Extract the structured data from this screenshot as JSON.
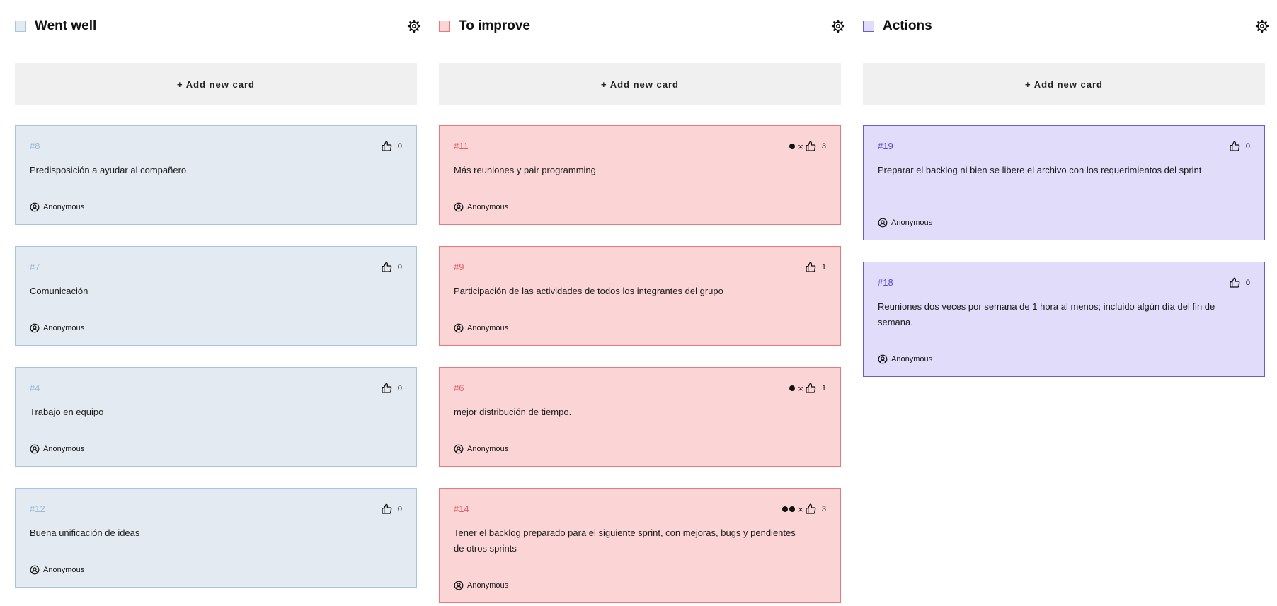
{
  "theme": {
    "went_well": {
      "bg": "#e3eaf2",
      "border": "#a8c4de",
      "id_color": "#9dbad4",
      "swatch_bg": "#e3eaf2",
      "swatch_border": "#a8c4de"
    },
    "to_improve": {
      "bg": "#fbd5d6",
      "border": "#e6797d",
      "id_color": "#e0606a",
      "swatch_bg": "#fbd5d6",
      "swatch_border": "#e6797d"
    },
    "actions": {
      "bg": "#e0dcf9",
      "border": "#6a5ae0",
      "id_color": "#5a48d6",
      "swatch_bg": "#e0dcf9",
      "swatch_border": "#6a5ae0"
    }
  },
  "columns": [
    {
      "key": "went_well",
      "title": "Went well",
      "add_label": "+ Add new card",
      "cards": [
        {
          "id": "#8",
          "text": "Predisposición a ayudar al compañero",
          "author": "Anonymous",
          "votes": "0",
          "voter_dots": 0,
          "can_remove": false
        },
        {
          "id": "#7",
          "text": "Comunicación",
          "author": "Anonymous",
          "votes": "0",
          "voter_dots": 0,
          "can_remove": false
        },
        {
          "id": "#4",
          "text": "Trabajo en equipo",
          "author": "Anonymous",
          "votes": "0",
          "voter_dots": 0,
          "can_remove": false
        },
        {
          "id": "#12",
          "text": "Buena unificación de ideas",
          "author": "Anonymous",
          "votes": "0",
          "voter_dots": 0,
          "can_remove": false
        }
      ]
    },
    {
      "key": "to_improve",
      "title": "To improve",
      "add_label": "+ Add new card",
      "cards": [
        {
          "id": "#11",
          "text": "Más reuniones y pair programming",
          "author": "Anonymous",
          "votes": "3",
          "voter_dots": 1,
          "can_remove": true
        },
        {
          "id": "#9",
          "text": "Participación de las actividades de todos los integrantes del grupo",
          "author": "Anonymous",
          "votes": "1",
          "voter_dots": 0,
          "can_remove": false
        },
        {
          "id": "#6",
          "text": "mejor distribución de tiempo.",
          "author": "Anonymous",
          "votes": "1",
          "voter_dots": 1,
          "can_remove": true
        },
        {
          "id": "#14",
          "text": "Tener el backlog preparado para el siguiente sprint, con mejoras, bugs y pendientes de otros sprints",
          "author": "Anonymous",
          "votes": "3",
          "voter_dots": 2,
          "can_remove": true
        }
      ]
    },
    {
      "key": "actions",
      "title": "Actions",
      "add_label": "+ Add new card",
      "cards": [
        {
          "id": "#19",
          "text": "Preparar el backlog ni bien se libere el archivo con los requerimientos del sprint",
          "author": "Anonymous",
          "votes": "0",
          "voter_dots": 0,
          "can_remove": false
        },
        {
          "id": "#18",
          "text": "Reuniones dos veces por semana de 1 hora al menos; incluido algún día del fin de semana.",
          "author": "Anonymous",
          "votes": "0",
          "voter_dots": 0,
          "can_remove": false
        }
      ]
    }
  ],
  "icons": {
    "settings": "gear-icon",
    "vote": "thumbs-up-icon",
    "author": "user-circle-icon",
    "remove_vote": "×"
  }
}
